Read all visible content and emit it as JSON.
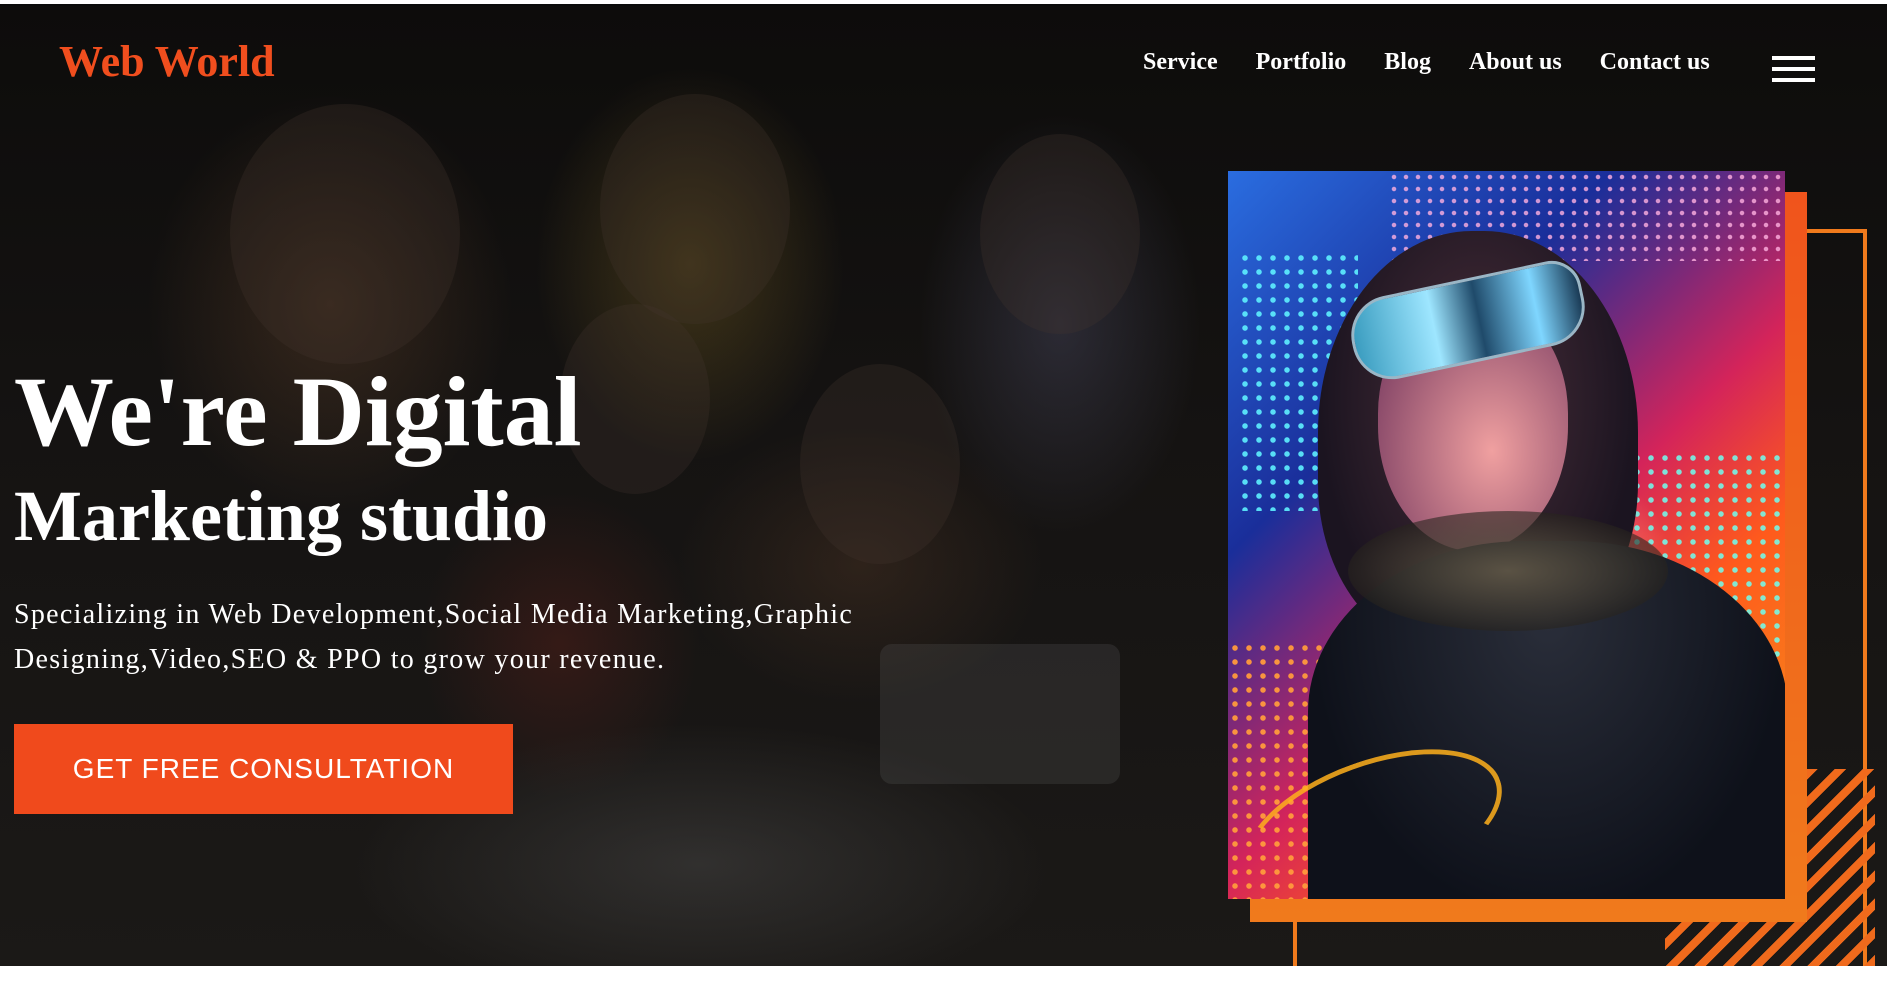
{
  "brand": {
    "name": "Web World",
    "color": "#f04e1e"
  },
  "nav": {
    "items": [
      {
        "label": "Service"
      },
      {
        "label": "Portfolio"
      },
      {
        "label": "Blog"
      },
      {
        "label": "About us"
      },
      {
        "label": "Contact us"
      }
    ],
    "menu_icon": "hamburger-icon"
  },
  "hero": {
    "title_line1": "We're Digital",
    "title_line2": "Marketing studio",
    "description": "Specializing in Web Development,Social Media Marketing,Graphic Designing,Video,SEO & PPO to grow your revenue.",
    "cta_label": "GET FREE CONSULTATION",
    "cta_color": "#f04a1c",
    "accent_color": "#f0641c"
  }
}
